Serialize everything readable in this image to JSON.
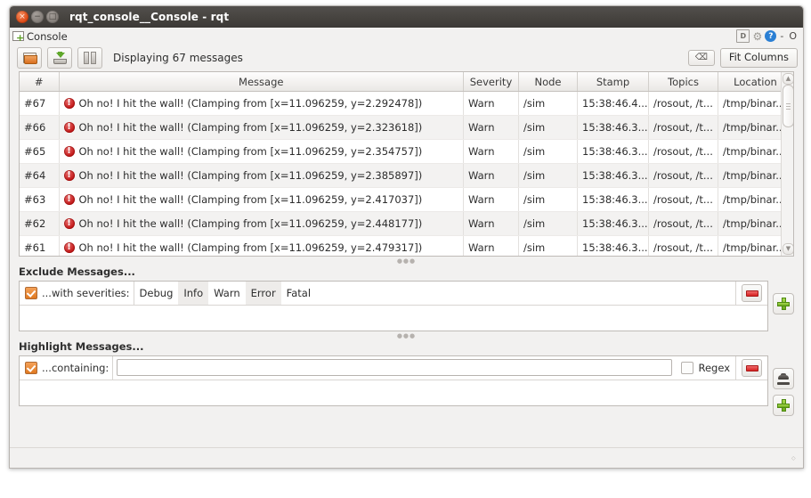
{
  "window": {
    "title": "rqt_console__Console - rqt",
    "controls": {
      "close": "×",
      "minimize": "−",
      "maximize": "□"
    }
  },
  "dock": {
    "title": "Console",
    "icon": "console-widget-icon",
    "right_icons": [
      "undock-icon",
      "settings-gear-icon",
      "help-icon"
    ],
    "dash": "-",
    "close_label": "O"
  },
  "toolbar": {
    "open_icon": "open-folder-icon",
    "save_icon": "save-icon",
    "pause_icon": "pause-icon",
    "status_text": "Displaying 67 messages",
    "clear_icon": "clear-messages-icon",
    "fit_columns_label": "Fit Columns"
  },
  "table": {
    "columns": [
      "#",
      "Message",
      "Severity",
      "Node",
      "Stamp",
      "Topics",
      "Location"
    ],
    "rows": [
      {
        "num": "#67",
        "message": "Oh no! I hit the wall! (Clamping from [x=11.096259, y=2.292478])",
        "severity": "Warn",
        "node": "/sim",
        "stamp": "15:38:46.4...",
        "topics": "/rosout, /t...",
        "location": "/tmp/binar..."
      },
      {
        "num": "#66",
        "message": "Oh no! I hit the wall! (Clamping from [x=11.096259, y=2.323618])",
        "severity": "Warn",
        "node": "/sim",
        "stamp": "15:38:46.3...",
        "topics": "/rosout, /t...",
        "location": "/tmp/binar..."
      },
      {
        "num": "#65",
        "message": "Oh no! I hit the wall! (Clamping from [x=11.096259, y=2.354757])",
        "severity": "Warn",
        "node": "/sim",
        "stamp": "15:38:46.3...",
        "topics": "/rosout, /t...",
        "location": "/tmp/binar..."
      },
      {
        "num": "#64",
        "message": "Oh no! I hit the wall! (Clamping from [x=11.096259, y=2.385897])",
        "severity": "Warn",
        "node": "/sim",
        "stamp": "15:38:46.3...",
        "topics": "/rosout, /t...",
        "location": "/tmp/binar..."
      },
      {
        "num": "#63",
        "message": "Oh no! I hit the wall! (Clamping from [x=11.096259, y=2.417037])",
        "severity": "Warn",
        "node": "/sim",
        "stamp": "15:38:46.3...",
        "topics": "/rosout, /t...",
        "location": "/tmp/binar..."
      },
      {
        "num": "#62",
        "message": "Oh no! I hit the wall! (Clamping from [x=11.096259, y=2.448177])",
        "severity": "Warn",
        "node": "/sim",
        "stamp": "15:38:46.3...",
        "topics": "/rosout, /t...",
        "location": "/tmp/binar..."
      },
      {
        "num": "#61",
        "message": "Oh no! I hit the wall! (Clamping from [x=11.096259, y=2.479317])",
        "severity": "Warn",
        "node": "/sim",
        "stamp": "15:38:46.3...",
        "topics": "/rosout, /t...",
        "location": "/tmp/binar..."
      }
    ]
  },
  "exclude": {
    "title": "Exclude Messages...",
    "row_label": "...with severities:",
    "severities": [
      "Debug",
      "Info",
      "Warn",
      "Error",
      "Fatal"
    ],
    "remove_icon": "remove-filter-icon",
    "add_icon": "add-filter-icon"
  },
  "highlight": {
    "title": "Highlight Messages...",
    "row_label": "...containing:",
    "input_value": "",
    "regex_label": "Regex",
    "remove_icon": "remove-filter-icon",
    "brush_icon": "highlight-brush-icon",
    "add_icon": "add-filter-icon"
  },
  "colors": {
    "accent": "#dd4814",
    "warn": "#a99a00",
    "error": "#c01414",
    "window_bg": "#f2f1f0"
  }
}
